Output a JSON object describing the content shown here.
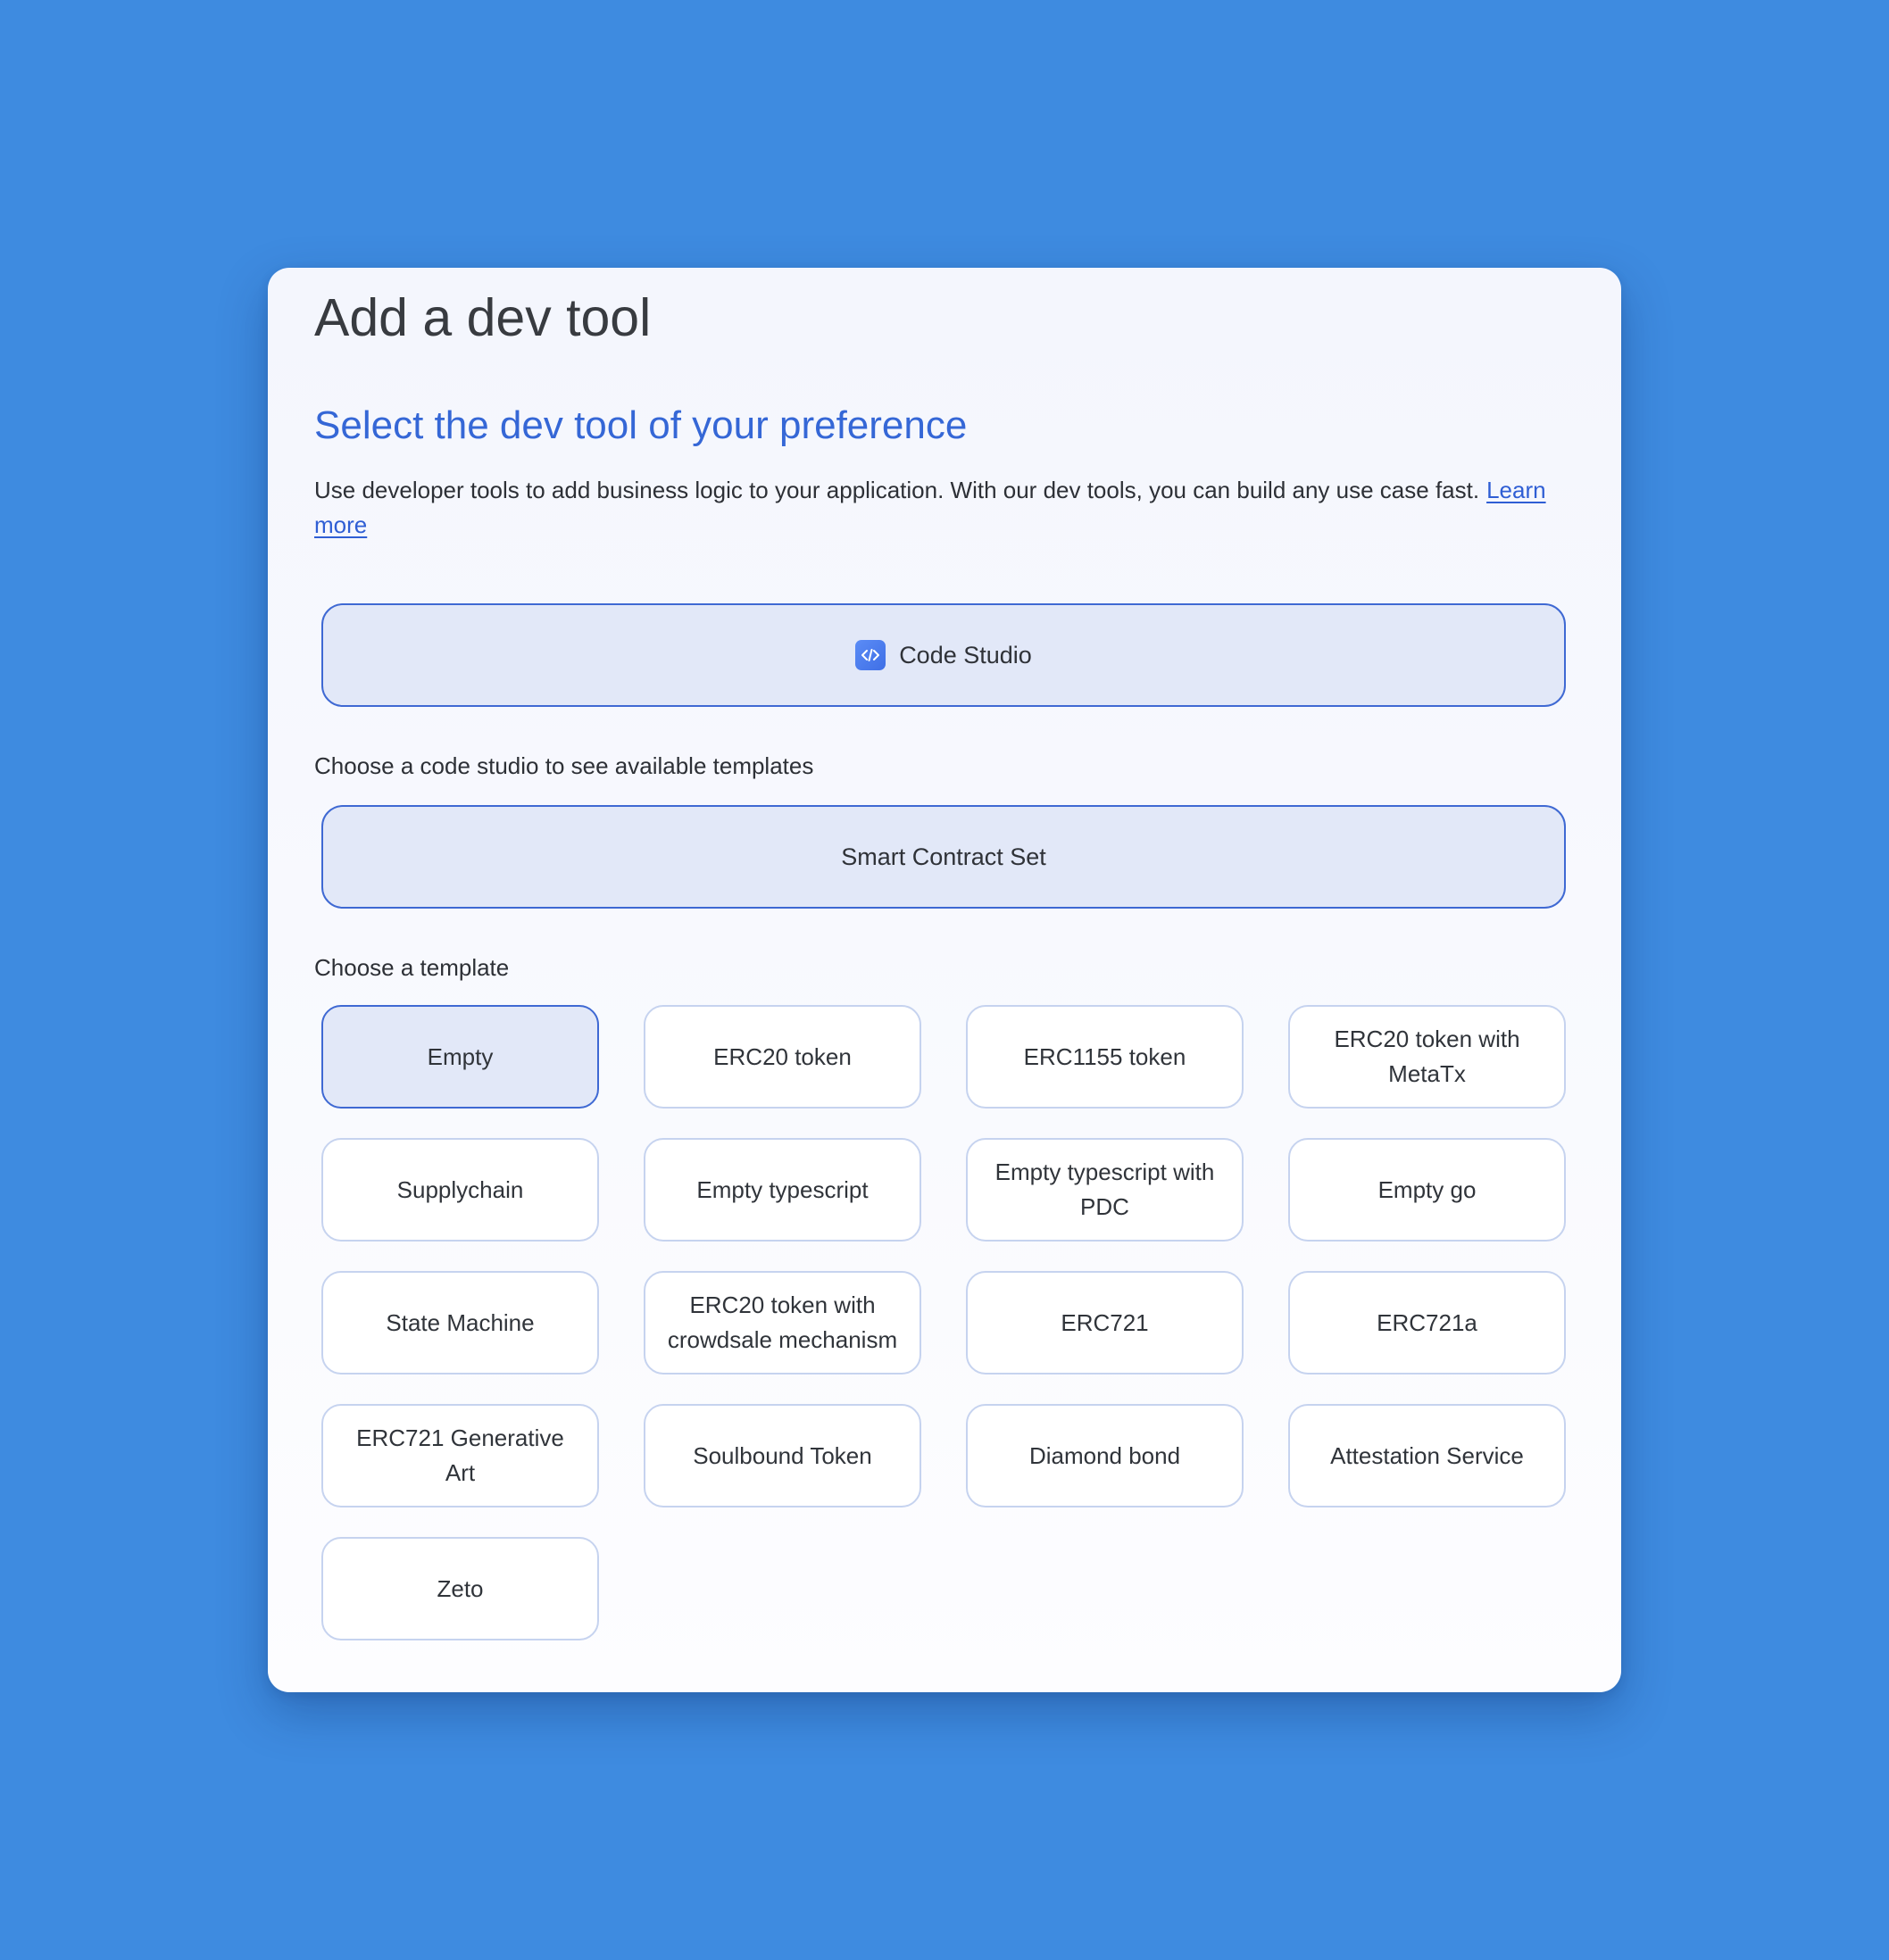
{
  "dialog": {
    "title": "Add a dev tool",
    "subtitle": "Select the dev tool of your preference",
    "description": "Use developer tools to add business logic to your application. With our dev tools, you can build any use case fast.",
    "learn_more": "Learn more"
  },
  "dev_tool": {
    "label": "Code Studio",
    "icon": "code-icon",
    "selected": true
  },
  "code_studio_prompt": "Choose a code studio to see available templates",
  "code_studio": {
    "label": "Smart Contract Set",
    "selected": true
  },
  "template_prompt": "Choose a template",
  "templates": [
    {
      "label": "Empty",
      "selected": true
    },
    {
      "label": "ERC20 token"
    },
    {
      "label": "ERC1155 token"
    },
    {
      "label": "ERC20 token with MetaTx"
    },
    {
      "label": "Supplychain"
    },
    {
      "label": "Empty typescript"
    },
    {
      "label": "Empty typescript with PDC"
    },
    {
      "label": "Empty go"
    },
    {
      "label": "State Machine"
    },
    {
      "label": "ERC20 token with crowdsale mechanism"
    },
    {
      "label": "ERC721"
    },
    {
      "label": "ERC721a"
    },
    {
      "label": "ERC721 Generative Art"
    },
    {
      "label": "Soulbound Token"
    },
    {
      "label": "Diamond bond"
    },
    {
      "label": "Attestation Service"
    },
    {
      "label": "Zeto"
    }
  ],
  "colors": {
    "background": "#3e8be0",
    "accent": "#3567d6",
    "selected_fill": "#e2e8f8",
    "selected_border": "#3f69d3",
    "tile_border": "#c6d3ef"
  }
}
